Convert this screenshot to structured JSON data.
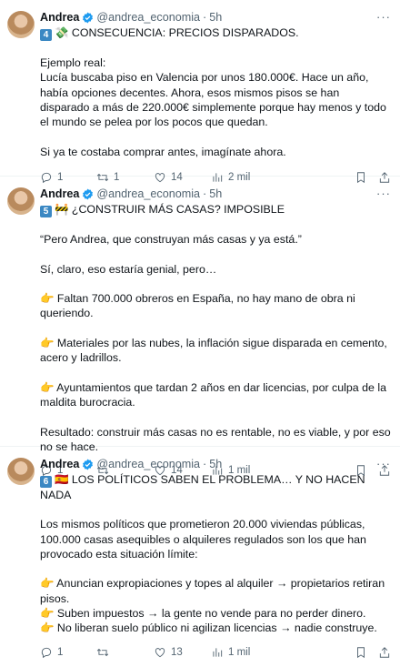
{
  "tweets": [
    {
      "name": "Andrea",
      "handle": "@andrea_economia",
      "time": "5h",
      "heading_num": "4",
      "heading_icon": "money-with-wings-icon",
      "heading": "💸 CONSECUENCIA: PRECIOS DISPARADOS.",
      "body": "Ejemplo real:\nLucía buscaba piso en Valencia por unos 180.000€. Hace un año, había opciones decentes. Ahora, esos mismos pisos se han disparado a más de 220.000€ simplemente porque hay menos y todo el mundo se pelea por los pocos que quedan.\n\nSi ya te costaba comprar antes, imagínate ahora.",
      "replies": "1",
      "retweets": "1",
      "likes": "14",
      "views": "2 mil"
    },
    {
      "name": "Andrea",
      "handle": "@andrea_economia",
      "time": "5h",
      "heading_num": "5",
      "heading_icon": "construction-barrier-icon",
      "heading": "🚧 ¿CONSTRUIR MÁS CASAS? IMPOSIBLE",
      "body": "“Pero Andrea, que construyan más casas y ya está.”\n\nSí, claro, eso estaría genial, pero…\n\n👉 Faltan 700.000 obreros en España, no hay mano de obra ni queriendo.\n\n👉 Materiales por las nubes, la inflación sigue disparada en cemento, acero y ladrillos.\n\n👉 Ayuntamientos que tardan 2 años en dar licencias, por culpa de la maldita burocracia.\n\nResultado: construir más casas no es rentable, no es viable, y por eso no se hace.",
      "replies": "1",
      "retweets": "",
      "likes": "14",
      "views": "1 mil"
    },
    {
      "name": "Andrea",
      "handle": "@andrea_economia",
      "time": "5h",
      "heading_num": "6",
      "heading_icon": "spain-flag-icon",
      "heading": "🇪🇸 LOS POLÍTICOS SABEN EL PROBLEMA… Y NO HACEN NADA",
      "body": "Los mismos políticos que prometieron 20.000 viviendas públicas, 100.000 casas asequibles o alquileres regulados son los que han provocado esta situación límite:\n\n👉 Anuncian expropiaciones y topes al alquiler → propietarios retiran pisos.\n👉 Suben impuestos → la gente no vende para no perder dinero.\n👉 No liberan suelo público ni agilizan licencias → nadie construye.",
      "replies": "1",
      "retweets": "",
      "likes": "13",
      "views": "1 mil"
    }
  ],
  "colors": {
    "verified": "#1d9bf0",
    "keycap": "#3b88c3",
    "muted": "#536471"
  }
}
